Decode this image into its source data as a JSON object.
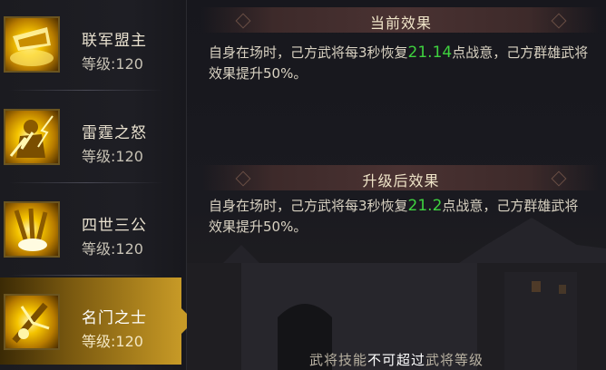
{
  "skills": [
    {
      "name": "联军盟主",
      "level": "等级:120",
      "selected": false
    },
    {
      "name": "雷霆之怒",
      "level": "等级:120",
      "selected": false
    },
    {
      "name": "四世三公",
      "level": "等级:120",
      "selected": false
    },
    {
      "name": "名门之士",
      "level": "等级:120",
      "selected": true
    }
  ],
  "current": {
    "title": "当前效果",
    "desc_pre": "自身在场时，己方武将每3秒恢复",
    "desc_value": "21.14",
    "desc_post": "点战意，己方群雄武将效果提升50%。"
  },
  "upgrade": {
    "title": "升级后效果",
    "desc_pre": "自身在场时，己方武将每3秒恢复",
    "desc_value": "21.2",
    "desc_post": "点战意，己方群雄武将效果提升50%。"
  },
  "footer": {
    "pre": "武将技能",
    "highlight": "不可超过",
    "post": "武将等级"
  },
  "colors": {
    "highlight_value": "#3fd23f",
    "selected_accent": "#c79a27"
  }
}
